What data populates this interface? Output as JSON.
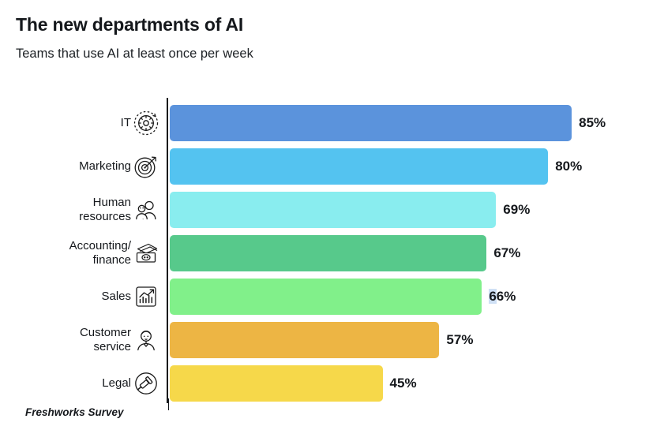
{
  "header": {
    "title": "The new departments of AI",
    "subtitle": "Teams that use AI at least once per week"
  },
  "footer": {
    "source": "Freshworks Survey"
  },
  "chart_data": {
    "type": "bar",
    "orientation": "horizontal",
    "title": "The new departments of AI",
    "subtitle": "Teams that use AI at least once per week",
    "xlabel": "",
    "ylabel": "",
    "xlim": [
      0,
      100
    ],
    "grid": false,
    "legend": false,
    "value_suffix": "%",
    "source": "Freshworks Survey",
    "categories": [
      "IT",
      "Marketing",
      "Human\nresources",
      "Accounting/\nfinance",
      "Sales",
      "Customer\nservice",
      "Legal"
    ],
    "values": [
      85,
      80,
      69,
      67,
      66,
      57,
      45
    ],
    "value_labels": [
      "85%",
      "80%",
      "69%",
      "67%",
      "66%",
      "57%",
      "45%"
    ],
    "colors": [
      "#5B93DC",
      "#54C3F0",
      "#89EDEF",
      "#57C98B",
      "#81F08A",
      "#EDB544",
      "#F6D84A"
    ],
    "icons": [
      "gear-icon",
      "target-icon",
      "people-icon",
      "money-icon",
      "bar-chart-icon",
      "support-agent-icon",
      "gavel-icon"
    ],
    "selection_highlight": {
      "row": 4,
      "text": "6"
    }
  }
}
